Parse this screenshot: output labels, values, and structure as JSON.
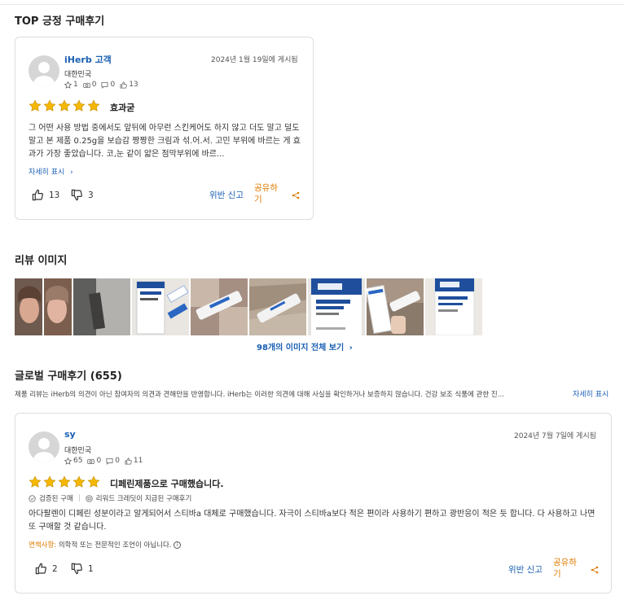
{
  "top_section": {
    "title": "TOP 긍정 구매후기",
    "review": {
      "user": "iHerb 고객",
      "country": "대한민국",
      "stats": {
        "rewards": "1",
        "photos": "0",
        "comments": "0",
        "helpful": "13"
      },
      "date": "2024년 1월 19일에 게시됨",
      "rating": 5,
      "title": "효과굳",
      "body": "그 어떤 사용 방법 중에서도 앞뒤에 아무런 스킨케어도 하지 않고 더도 말고 덜도 말고 본 제품 0.25g을 보습감 짱짱한 크림과 섞.어.서. 고민 부위에 바르는 게 효과가 가장 좋았습니다. 코,눈 같이 얇은 점막부위에 바르...",
      "read_more": "자세히 표시",
      "likes": "13",
      "dislikes": "3",
      "report": "위반 신고",
      "share": "공유하기"
    }
  },
  "images_section": {
    "title": "리뷰 이미지",
    "see_all": "98개의 이미지 전체 보기",
    "thumbnails": [
      "selfie-photo",
      "dark-photo",
      "panoxyl-box",
      "tube-on-fabric",
      "tube-in-hand",
      "panoxyl-box-front",
      "tube-cap",
      "panoxyl-box-2"
    ]
  },
  "global_section": {
    "title": "글로벌 구매후기 (655)",
    "disclaimer": "제품 리뷰는 iHerb의 의견이 아닌 참여자의 의견과 견해만을 반영합니다. iHerb는 이러한 의견에 대해 사실을 확인하거나 보증하지 않습니다. 건강 보조 식품에 관한 진...",
    "disclaimer_more": "자세히 표시",
    "review": {
      "user": "sy",
      "country": "대한민국",
      "stats": {
        "rewards": "65",
        "photos": "0",
        "comments": "0",
        "helpful": "11"
      },
      "date": "2024년 7월 7일에 게시됨",
      "rating": 5,
      "title": "디페린제품으로 구매했습니다.",
      "verified": "검증된 구매",
      "reward_credit": "리워드 크레딧이 지급된 구매후기",
      "body": "아다팔렌이 디페린 성분이라고 알게되어서 스티바a 대체로 구매했습니다. 자극이 스티바a보다 적은 편이라 사용하기 편하고 광반응이 적은 듯 합니다. 다 사용하고 나면 또 구매할 것 같습니다.",
      "caution_label": "면책사항:",
      "caution_text": "의학적 또는 전문적인 조언이 아닙니다.",
      "likes": "2",
      "dislikes": "1",
      "report": "위반 신고",
      "share": "공유하기"
    }
  },
  "colors": {
    "link": "#1a5fb4",
    "star": "#f5b800",
    "share": "#e07b00"
  }
}
